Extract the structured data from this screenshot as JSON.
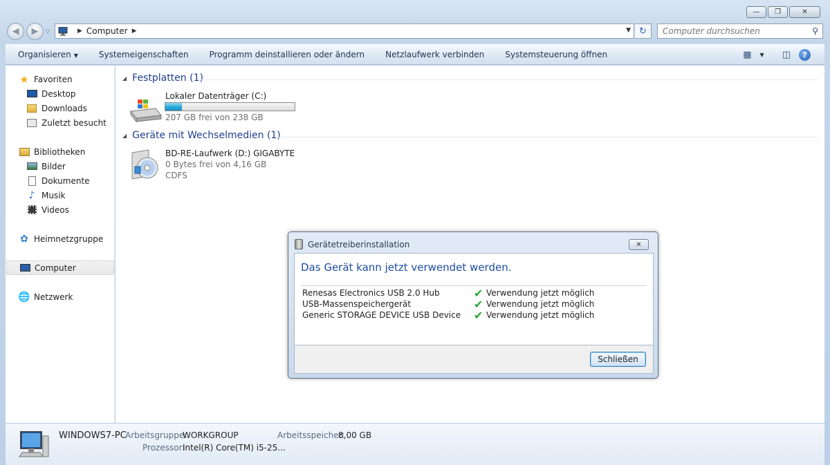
{
  "window": {
    "caption_buttons": [
      "minimize",
      "maximize",
      "close"
    ]
  },
  "address": {
    "crumb": "Computer"
  },
  "search": {
    "placeholder": "Computer durchsuchen"
  },
  "toolbar": {
    "items": [
      "Organisieren",
      "Systemeigenschaften",
      "Programm deinstallieren oder ändern",
      "Netzlaufwerk verbinden",
      "Systemsteuerung öffnen"
    ]
  },
  "sidebar": {
    "favorites": {
      "label": "Favoriten",
      "items": [
        "Desktop",
        "Downloads",
        "Zuletzt besucht"
      ]
    },
    "libraries": {
      "label": "Bibliotheken",
      "items": [
        "Bilder",
        "Dokumente",
        "Musik",
        "Videos"
      ]
    },
    "homegroup": "Heimnetzgruppe",
    "computer": "Computer",
    "network": "Netzwerk"
  },
  "groups": {
    "hard_disks": {
      "header": "Festplatten (1)",
      "drive": {
        "name": "Lokaler Datenträger (C:)",
        "free": "207 GB frei von 238 GB",
        "used_fraction": 0.13
      }
    },
    "removable": {
      "header": "Geräte mit Wechselmedien (1)",
      "drive": {
        "name": "BD-RE-Laufwerk (D:) GIGABYTE",
        "free": "0 Bytes frei von 4,16 GB",
        "fs": "CDFS"
      }
    }
  },
  "details": {
    "pc_name": "WINDOWS7-PC",
    "workgroup_label": "Arbeitsgruppe:",
    "workgroup": "WORKGROUP",
    "memory_label": "Arbeitsspeicher:",
    "memory": "8,00 GB",
    "processor_label": "Prozessor:",
    "processor": "Intel(R) Core(TM) i5-25..."
  },
  "dialog": {
    "title": "Gerätetreiberinstallation",
    "heading": "Das Gerät kann jetzt verwendet werden.",
    "devices": [
      {
        "name": "Renesas Electronics USB 2.0 Hub",
        "status": "Verwendung jetzt möglich"
      },
      {
        "name": "USB-Massenspeichergerät",
        "status": "Verwendung jetzt möglich"
      },
      {
        "name": "Generic STORAGE DEVICE USB Device",
        "status": "Verwendung jetzt möglich"
      }
    ],
    "close_button": "Schließen"
  }
}
